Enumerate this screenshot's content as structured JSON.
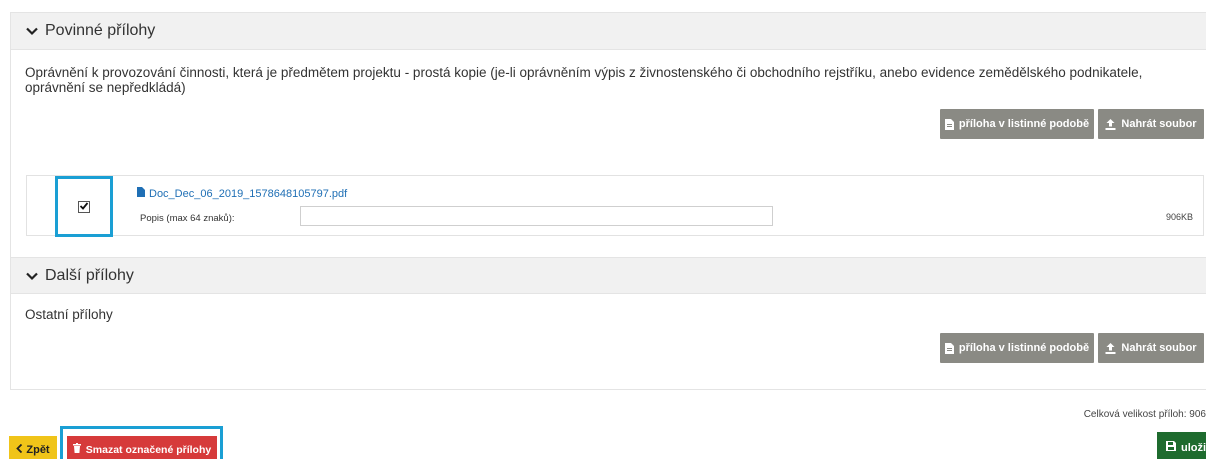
{
  "sections": {
    "mandatory": {
      "title": "Povinné přílohy",
      "description": "Oprávnění k provozování činnosti, která je předmětem projektu - prostá kopie (je-li oprávněním výpis z živnostenského či obchodního rejstříku, anebo evidence zemědělského podnikatele, oprávnění se nepředkládá)",
      "paper_button": "příloha v listinné podobě",
      "upload_button": "Nahrát soubor",
      "file": {
        "name": "Doc_Dec_06_2019_1578648105797.pdf",
        "checked": true,
        "description_label": "Popis (max 64 znaků):",
        "description_value": "",
        "size": "906KB"
      }
    },
    "other": {
      "title": "Další přílohy",
      "description": "Ostatní přílohy",
      "paper_button": "příloha v listinné podobě",
      "upload_button": "Nahrát soubor"
    }
  },
  "footer": {
    "total_size": "Celková velikost příloh: 906",
    "back_button": "Zpět",
    "delete_button": "Smazat označené přílohy",
    "save_button": "uloži"
  },
  "colors": {
    "grey_button": "#8a8a84",
    "back_button": "#f0c419",
    "delete_button": "#d63a3a",
    "save_button": "#1e6b2e",
    "highlight": "#1a9fd4",
    "link": "#1f6fb5"
  },
  "icons": [
    "chevron-down-icon",
    "document-icon",
    "upload-icon",
    "pdf-file-icon",
    "checkmark-icon",
    "chevron-left-icon",
    "trash-icon",
    "floppy-disk-icon"
  ]
}
